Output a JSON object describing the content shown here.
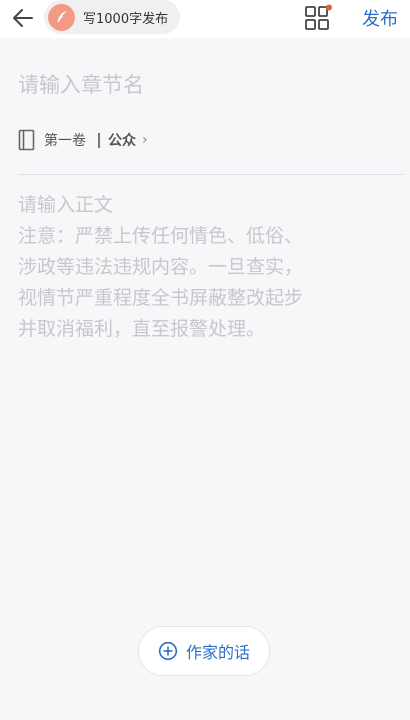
{
  "header": {
    "back_icon": "arrow-left-icon",
    "target_label": "写1000字发布",
    "target_icon": "quill-pen-icon",
    "grid_icon": "grid-apps-icon",
    "publish_label": "发布",
    "accent_color": "#2b6fc9",
    "badge_color": "#e85c3a"
  },
  "editor": {
    "chapter_placeholder": "请输入章节名",
    "volume_icon": "book-icon",
    "volume_name": "第一卷",
    "volume_sub": "公众",
    "volume_chevron": "›",
    "body_placeholder": [
      "请输入正文",
      "注意：严禁上传任何情色、低俗、",
      "涉政等违法违规内容。一旦查实，",
      "视情节严重程度全书屏蔽整改起步",
      "并取消福利，直至报警处理。"
    ]
  },
  "footer": {
    "author_note_label": "作家的话",
    "author_note_icon": "plus-circle-icon"
  }
}
